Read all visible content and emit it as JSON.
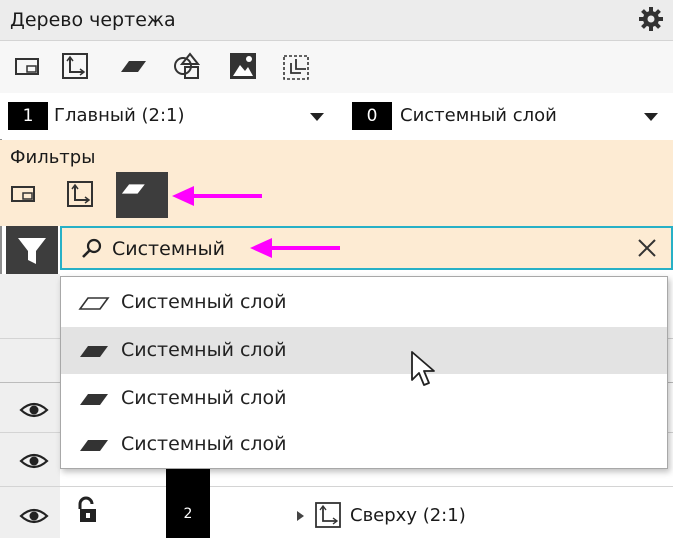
{
  "panel": {
    "title": "Дерево чертежа"
  },
  "view_selector": {
    "badge": "1",
    "value": "Главный (2:1)"
  },
  "layer_selector": {
    "badge": "0",
    "value": "Системный слой"
  },
  "filters": {
    "label": "Фильтры"
  },
  "search": {
    "value": "Системный"
  },
  "dropdown": {
    "items": [
      {
        "label": "Системный слой",
        "icon": "layer-outline-icon"
      },
      {
        "label": "Системный слой",
        "icon": "layer-filled-icon"
      },
      {
        "label": "Системный слой",
        "icon": "layer-filled-icon"
      },
      {
        "label": "Системный слой",
        "icon": "layer-filled-icon"
      }
    ]
  },
  "tree": {
    "row_number": "2",
    "row_label": "Сверху (2:1)"
  },
  "colors": {
    "accent_cyan": "#27b0c6",
    "highlight_magenta": "#ff00ff",
    "filters_bg": "#fdebd3",
    "active_filter_bg": "#3d3d3d"
  }
}
